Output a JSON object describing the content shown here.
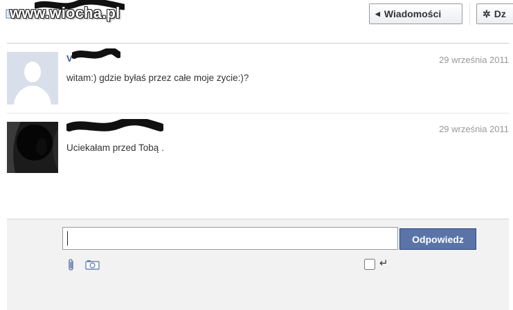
{
  "watermark": {
    "logo_text": "www.wiocha.pl"
  },
  "header": {
    "back_button_label": "Wiadomości",
    "actions_button_label": "Dz"
  },
  "messages": [
    {
      "sender": "V",
      "date": "29 września 2011",
      "text": "witam:) gdzie byłaś przez całe moje zycie:)?"
    },
    {
      "sender": "",
      "date": "29 września 2011",
      "text": "Uciekałam przed Tobą ."
    }
  ],
  "reply": {
    "input_value": "",
    "button_label": "Odpowiedz",
    "send_on_enter_checked": false
  },
  "icons": {
    "attach": "paperclip-icon",
    "camera": "camera-icon",
    "enter": "enter-key-icon",
    "back": "triangle-left-icon",
    "actions": "gear-icon"
  },
  "colors": {
    "accent": "#5b74a8",
    "link": "#3b5998",
    "date": "#999999",
    "reply_bg": "#f2f2f2"
  }
}
